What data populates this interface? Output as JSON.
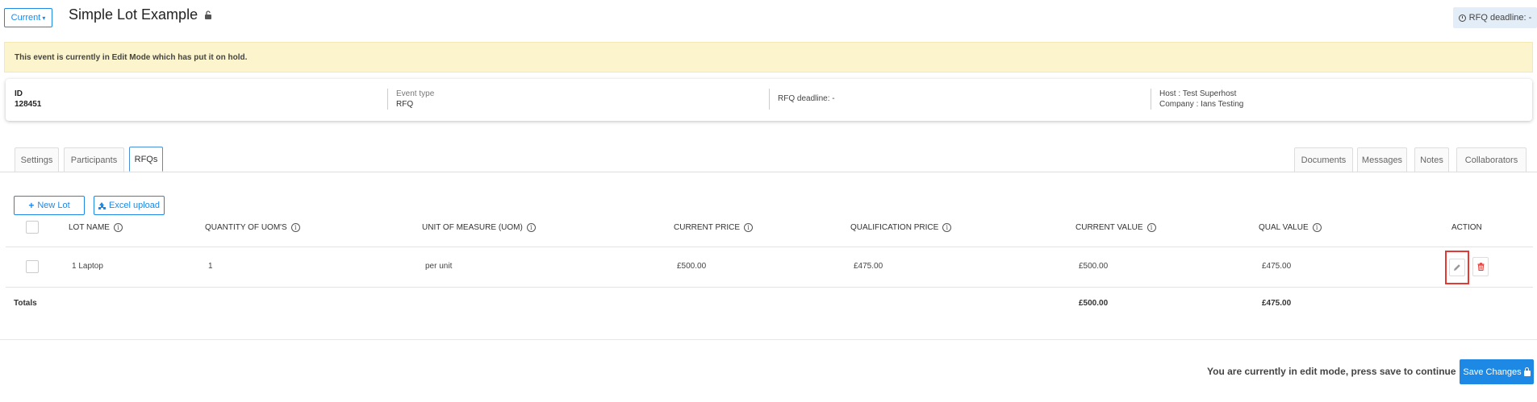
{
  "header": {
    "version_label": "Current",
    "title": "Simple Lot Example",
    "rfq_deadline_badge": "RFQ deadline: -"
  },
  "alert": {
    "text": "This event is currently in Edit Mode which has put it on hold."
  },
  "event_info": {
    "id_label": "ID",
    "id_value": "128451",
    "event_type_label": "Event type",
    "event_type_value": "RFQ",
    "rfq_deadline": "RFQ deadline: -",
    "host": "Host : Test Superhost",
    "company": "Company : Ians Testing"
  },
  "tabs": {
    "left": [
      "Settings",
      "Participants",
      "RFQs"
    ],
    "right": [
      "Documents",
      "Messages",
      "Notes",
      "Collaborators"
    ],
    "active": "RFQs"
  },
  "toolbar": {
    "new_lot_label": "New Lot",
    "excel_upload_label": "Excel upload"
  },
  "table": {
    "columns": [
      "LOT NAME",
      "QUANTITY OF UOM'S",
      "UNIT OF MEASURE (UOM)",
      "CURRENT PRICE",
      "QUALIFICATION PRICE",
      "CURRENT VALUE",
      "QUAL VALUE",
      "ACTION"
    ],
    "rows": [
      {
        "lot_name": "1 Laptop",
        "quantity": "1",
        "uom": "per unit",
        "current_price": "£500.00",
        "qualification_price": "£475.00",
        "current_value": "£500.00",
        "qual_value": "£475.00"
      }
    ],
    "totals_label": "Totals",
    "totals_current_value": "£500.00",
    "totals_qual_value": "£475.00"
  },
  "footer": {
    "message": "You are currently in edit mode, press save to continue",
    "save_label": "Save Changes"
  },
  "colors": {
    "accent": "#1e88e5",
    "alert_bg": "#fcf4cc",
    "highlight": "#e53935",
    "delete": "#e53935"
  }
}
